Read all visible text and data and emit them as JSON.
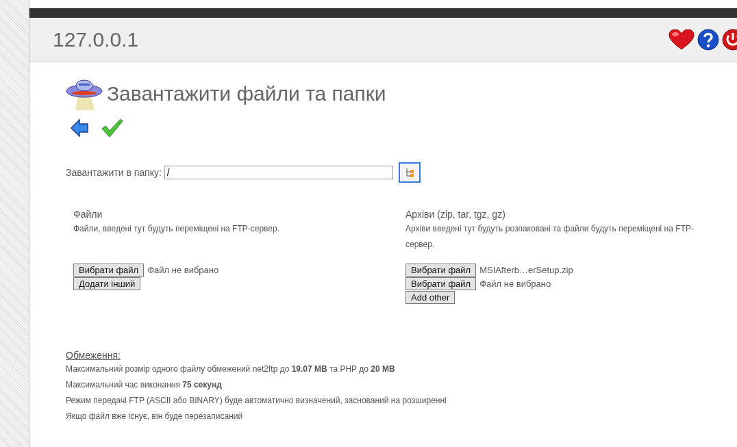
{
  "header": {
    "title": "127.0.0.1"
  },
  "page": {
    "title": "Завантажити файли та папки"
  },
  "target": {
    "label": "Завантажити в папку:",
    "value": "/"
  },
  "columns": [
    {
      "heading": "Файли",
      "description": "Файли, введені тут будуть переміщені на FTP-сервер.",
      "inputs": [
        {
          "button": "Вибрати файл",
          "file": "Файл не вибрано"
        }
      ],
      "add_button": "Додати інший"
    },
    {
      "heading": "Архіви (zip, tar, tgz, gz)",
      "description": "Архіви введені тут будуть розпаковані та файли будуть переміщені на FTP-сервер.",
      "inputs": [
        {
          "button": "Вибрати файл",
          "file": "MSIAfterb…erSetup.zip"
        },
        {
          "button": "Вибрати файл",
          "file": "Файл не вибрано"
        }
      ],
      "add_button": "Add other"
    }
  ],
  "limits": {
    "heading": "Обмеження:",
    "lines": [
      "Максимальний розмір одного файлу обмежений net2ftp до **19.07 MB** та PHP до **20 MB**",
      "Максимальний час виконання **75 секунд**",
      "Режим передачі FTP (ASCII або BINARY) буде автоматично визначений, заснований на розширенні",
      "Якщо файл вже існує, він буде перезаписаний"
    ]
  }
}
